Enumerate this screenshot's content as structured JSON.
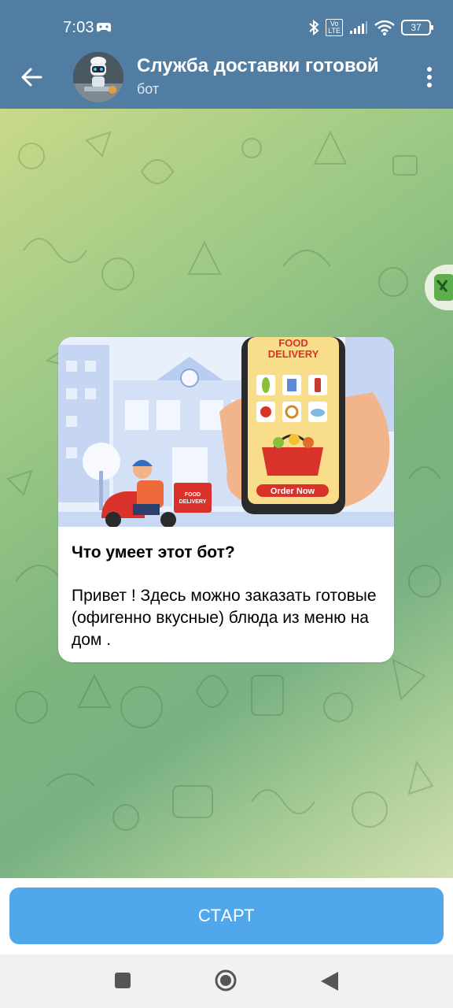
{
  "status_bar": {
    "time": "7:03",
    "battery": "37",
    "network_badge": "Vo\nLTE",
    "icons": [
      "game-controller-icon",
      "bluetooth-icon",
      "volte-icon",
      "signal-icon",
      "wifi-icon",
      "battery-icon"
    ]
  },
  "header": {
    "title": "Служба доставки готовой",
    "subtitle": "бот",
    "back_icon": "arrow-left-icon",
    "menu_icon": "more-vertical-icon"
  },
  "card": {
    "image": {
      "top_label_line1": "FOOD",
      "top_label_line2": "DELIVERY",
      "box_label_line1": "FOOD",
      "box_label_line2": "DELIVERY",
      "button": "Order Now"
    },
    "title": "Что умеет этот бот?",
    "text": "Привет ! Здесь можно заказать готовые (офигенно вкусные) блюда из меню на дом ."
  },
  "actions": {
    "start_label": "СТАРТ"
  },
  "nav": {
    "icons": [
      "square-recents-icon",
      "circle-home-icon",
      "triangle-back-icon"
    ]
  },
  "colors": {
    "header": "#517da2",
    "button": "#50a7ea"
  }
}
